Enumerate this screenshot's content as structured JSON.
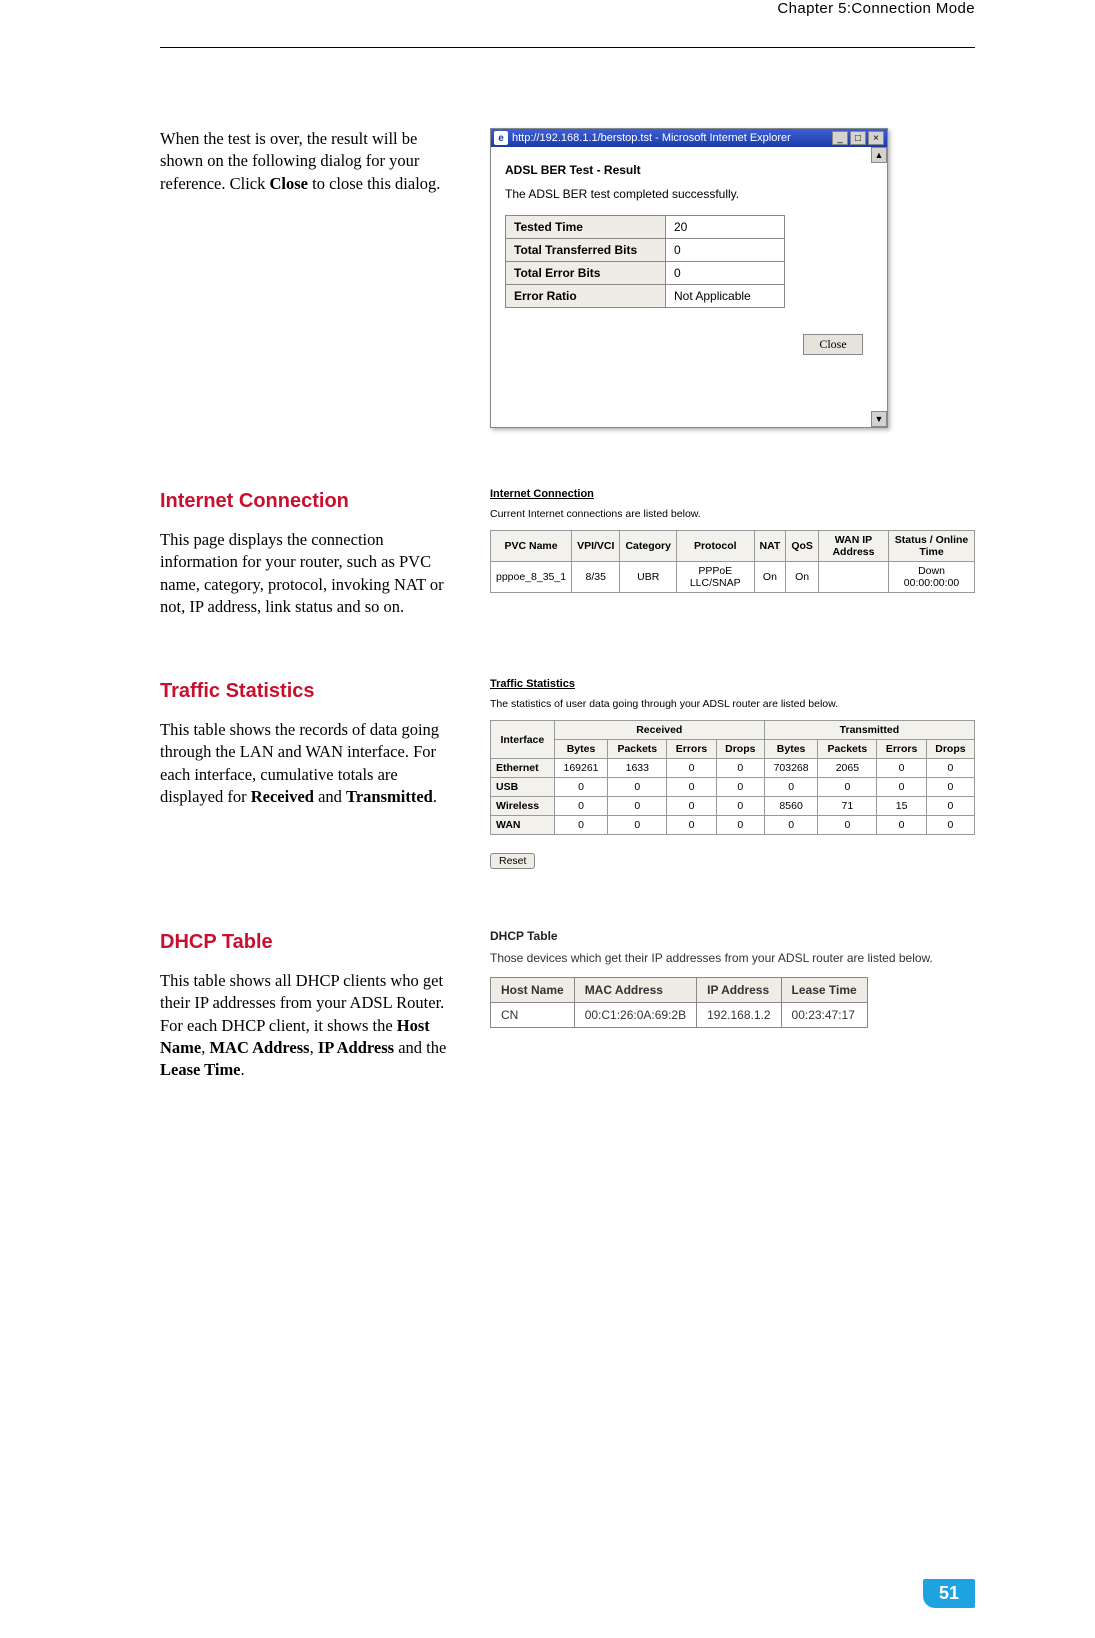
{
  "header": {
    "chapter": "Chapter 5:Connection Mode"
  },
  "sec1": {
    "text_pre": "When the test is over, the result will be shown on the following dialog for your reference. Click ",
    "text_bold": "Close",
    "text_post": " to close this dialog.",
    "dialog": {
      "title": "http://192.168.1.1/berstop.tst - Microsoft Internet Explorer",
      "heading": "ADSL BER Test - Result",
      "message": "The ADSL BER test completed successfully.",
      "rows": [
        {
          "k": "Tested Time",
          "v": "20"
        },
        {
          "k": "Total Transferred Bits",
          "v": "0"
        },
        {
          "k": "Total Error Bits",
          "v": "0"
        },
        {
          "k": "Error Ratio",
          "v": "Not Applicable"
        }
      ],
      "close_label": "Close"
    }
  },
  "sec2": {
    "heading": "Internet Connection",
    "text": "This page displays the connection information for your router, such as PVC name, category, protocol, invoking NAT or not, IP address, link status and so on.",
    "panel": {
      "title": "Internet Connection",
      "sub": "Current Internet connections are listed below.",
      "headers": [
        "PVC Name",
        "VPI/VCI",
        "Category",
        "Protocol",
        "NAT",
        "QoS",
        "WAN IP Address",
        "Status / Online Time"
      ],
      "row": [
        "pppoe_8_35_1",
        "8/35",
        "UBR",
        "PPPoE LLC/SNAP",
        "On",
        "On",
        "",
        "Down 00:00:00:00"
      ]
    }
  },
  "sec3": {
    "heading": "Traffic Statistics",
    "text_pre": "This table shows the records of data going through the LAN and WAN interface. For each interface, cumulative totals are displayed for ",
    "b1": "Received",
    "mid": " and ",
    "b2": "Transmitted",
    "post": ".",
    "panel": {
      "title": "Traffic Statistics",
      "sub": "The statistics of user data going through your ADSL router are listed below.",
      "groups": [
        "Received",
        "Transmitted"
      ],
      "sub_headers": [
        "Bytes",
        "Packets",
        "Errors",
        "Drops",
        "Bytes",
        "Packets",
        "Errors",
        "Drops"
      ],
      "rows": [
        {
          "iface": "Ethernet",
          "v": [
            "169261",
            "1633",
            "0",
            "0",
            "703268",
            "2065",
            "0",
            "0"
          ]
        },
        {
          "iface": "USB",
          "v": [
            "0",
            "0",
            "0",
            "0",
            "0",
            "0",
            "0",
            "0"
          ]
        },
        {
          "iface": "Wireless",
          "v": [
            "0",
            "0",
            "0",
            "0",
            "8560",
            "71",
            "15",
            "0"
          ]
        },
        {
          "iface": "WAN",
          "v": [
            "0",
            "0",
            "0",
            "0",
            "0",
            "0",
            "0",
            "0"
          ]
        }
      ],
      "reset": "Reset"
    }
  },
  "sec4": {
    "heading": "DHCP Table",
    "text_pre": "This table shows all DHCP clients who get their IP addresses from your ADSL Router. For each DHCP client, it shows the ",
    "b1": "Host Name",
    "c1": ", ",
    "b2": "MAC Address",
    "c2": ", ",
    "b3": "IP Address",
    "c3": " and the ",
    "b4": "Lease Time",
    "post": ".",
    "panel": {
      "title": "DHCP Table",
      "sub": "Those devices which get their IP addresses from your ADSL router are listed below.",
      "headers": [
        "Host Name",
        "MAC Address",
        "IP Address",
        "Lease Time"
      ],
      "row": [
        "CN",
        "00:C1:26:0A:69:2B",
        "192.168.1.2",
        "00:23:47:17"
      ]
    }
  },
  "footer": {
    "page": "51"
  }
}
